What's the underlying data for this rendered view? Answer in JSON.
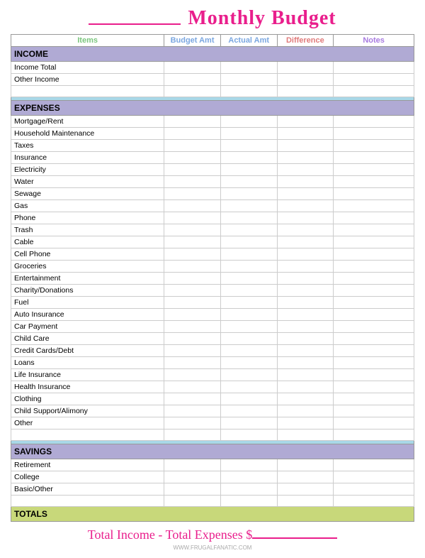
{
  "header": {
    "title": "Monthly Budget",
    "underline_placeholder": "___________"
  },
  "columns": {
    "items": "Items",
    "budget": "Budget Amt",
    "actual": "Actual Amt",
    "difference": "Difference",
    "notes": "Notes"
  },
  "sections": {
    "income": {
      "label": "INCOME",
      "rows": [
        {
          "item": "Income Total"
        },
        {
          "item": "Other Income"
        },
        {
          "item": ""
        }
      ]
    },
    "expenses": {
      "label": "EXPENSES",
      "rows": [
        {
          "item": "Mortgage/Rent"
        },
        {
          "item": "Household Maintenance"
        },
        {
          "item": "Taxes"
        },
        {
          "item": "Insurance"
        },
        {
          "item": "Electricity"
        },
        {
          "item": "Water"
        },
        {
          "item": "Sewage"
        },
        {
          "item": "Gas"
        },
        {
          "item": "Phone"
        },
        {
          "item": "Trash"
        },
        {
          "item": "Cable"
        },
        {
          "item": "Cell Phone"
        },
        {
          "item": "Groceries"
        },
        {
          "item": "Entertainment"
        },
        {
          "item": "Charity/Donations"
        },
        {
          "item": "Fuel"
        },
        {
          "item": "Auto Insurance"
        },
        {
          "item": "Car Payment"
        },
        {
          "item": "Child Care"
        },
        {
          "item": "Credit Cards/Debt"
        },
        {
          "item": "Loans"
        },
        {
          "item": "Life Insurance"
        },
        {
          "item": "Health Insurance"
        },
        {
          "item": "Clothing"
        },
        {
          "item": "Child Support/Alimony"
        },
        {
          "item": "Other"
        },
        {
          "item": ""
        }
      ]
    },
    "savings": {
      "label": "SAVINGS",
      "rows": [
        {
          "item": "Retirement"
        },
        {
          "item": "College"
        },
        {
          "item": "Basic/Other"
        },
        {
          "item": ""
        }
      ]
    },
    "totals": {
      "label": "TOTALS"
    }
  },
  "footer": {
    "text": "Total Income - Total Expenses $",
    "underline": "_______"
  },
  "watermark": "WWW.FRUGALFANATIC.COM"
}
